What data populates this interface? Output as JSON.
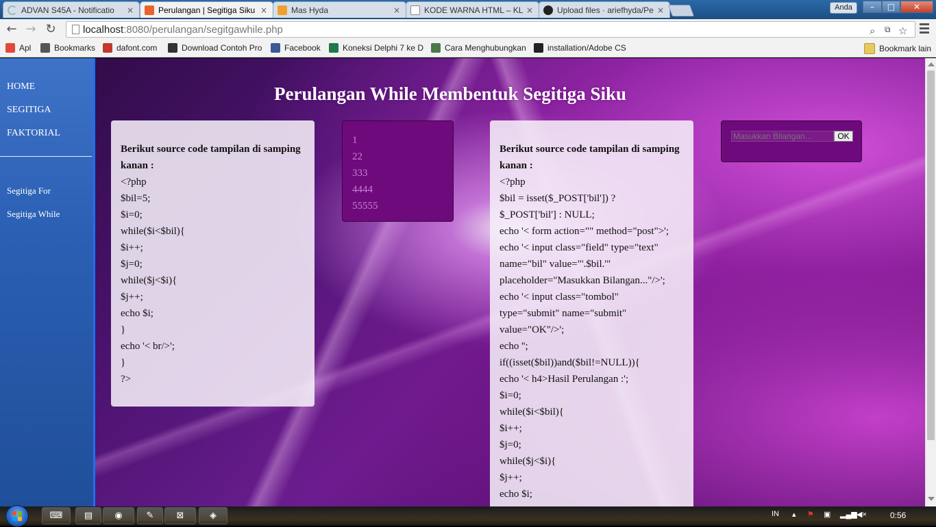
{
  "tabs": [
    {
      "title": "ADVAN S45A - Notificatio",
      "icon": "loading-icon",
      "active": false
    },
    {
      "title": "Perulangan | Segitiga Siku",
      "icon": "xampp-icon",
      "active": true
    },
    {
      "title": "Mas Hyda",
      "icon": "blogger-icon",
      "active": false
    },
    {
      "title": "KODE WARNA HTML – KL",
      "icon": "page-icon",
      "active": false
    },
    {
      "title": "Upload files · ariefhyda/Pe",
      "icon": "github-icon",
      "active": false
    }
  ],
  "tab_close": "×",
  "user_badge": "Anda",
  "window_buttons": {
    "min": "–",
    "max": "□",
    "close": "✕"
  },
  "toolbar": {
    "back": "←",
    "forward": "→",
    "reload": "↻",
    "url_host": "localhost",
    "url_rest": ":8080/perulangan/segitgawhile.php"
  },
  "bookmarks": [
    {
      "label": "Apl",
      "icon": "apps-icon",
      "color": "#e04a3b"
    },
    {
      "label": "Bookmarks",
      "icon": "star-icon",
      "color": "#555555"
    },
    {
      "label": "dafont.com",
      "icon": "dafont-icon",
      "color": "#c0392b"
    },
    {
      "label": "Download Contoh Pro",
      "icon": "globe-icon",
      "color": "#333333"
    },
    {
      "label": "Facebook",
      "icon": "facebook-icon",
      "color": "#3b5998"
    },
    {
      "label": "Koneksi Delphi 7 ke D",
      "icon": "site-icon",
      "color": "#1e7a4a"
    },
    {
      "label": "Cara Menghubungkan",
      "icon": "site-icon",
      "color": "#4a7a4a"
    },
    {
      "label": "installation/Adobe CS",
      "icon": "github-icon",
      "color": "#222222"
    }
  ],
  "bookmark_other": "Bookmark lain",
  "sidebar": {
    "top_items": [
      "HOME",
      "SEGITIGA",
      "FAKTORIAL"
    ],
    "sub_items": [
      "Segitiga For",
      "Segitiga While"
    ]
  },
  "page_title": "Perulangan While Membentuk Segitiga Siku",
  "left_panel": {
    "lead": "Berikut source code tampilan di samping kanan :",
    "lines": [
      "<?php",
      "$bil=5;",
      "$i=0;",
      "while($i<$bil){",
      "$i++;",
      "$j=0;",
      "while($j<$i){",
      "$j++;",
      "echo $i;",
      "}",
      "echo '< br/>';",
      "}",
      "?>"
    ]
  },
  "result": [
    "1",
    "22",
    "333",
    "4444",
    "55555"
  ],
  "right_panel": {
    "lead": "Berikut source code tampilan di samping kanan :",
    "lines": [
      "<?php",
      "$bil = isset($_POST['bil']) ?",
      "$_POST['bil'] : NULL;",
      "echo '< form action=\"\" method=\"post\">';",
      "echo '< input class=\"field\" type=\"text\"",
      "name=\"bil\" value=\"'.$bil.'\"",
      "placeholder=\"Masukkan Bilangan...\"/>';",
      "echo '< input class=\"tombol\"",
      "type=\"submit\" name=\"submit\"",
      "value=\"OK\"/>';",
      "echo '';",
      "if((isset($bil))and($bil!=NULL)){",
      "echo '< h4>Hasil Perulangan :';",
      "$i=0;",
      "while($i<$bil){",
      "$i++;",
      "$j=0;",
      "while($j<$i){",
      "$j++;",
      "echo $i;"
    ]
  },
  "form": {
    "placeholder": "Masukkan Bilangan...",
    "button": "OK"
  },
  "taskbar": {
    "apps": [
      {
        "name": "keyboard-icon",
        "glyph": "⌨"
      },
      {
        "name": "folder-icon",
        "glyph": "▤"
      },
      {
        "name": "chrome-icon",
        "glyph": "◉"
      },
      {
        "name": "notepad-icon",
        "glyph": "✎"
      },
      {
        "name": "xampp-icon",
        "glyph": "⊠"
      },
      {
        "name": "app-icon",
        "glyph": "◈"
      }
    ],
    "lang": "IN",
    "clock": "0:56"
  }
}
